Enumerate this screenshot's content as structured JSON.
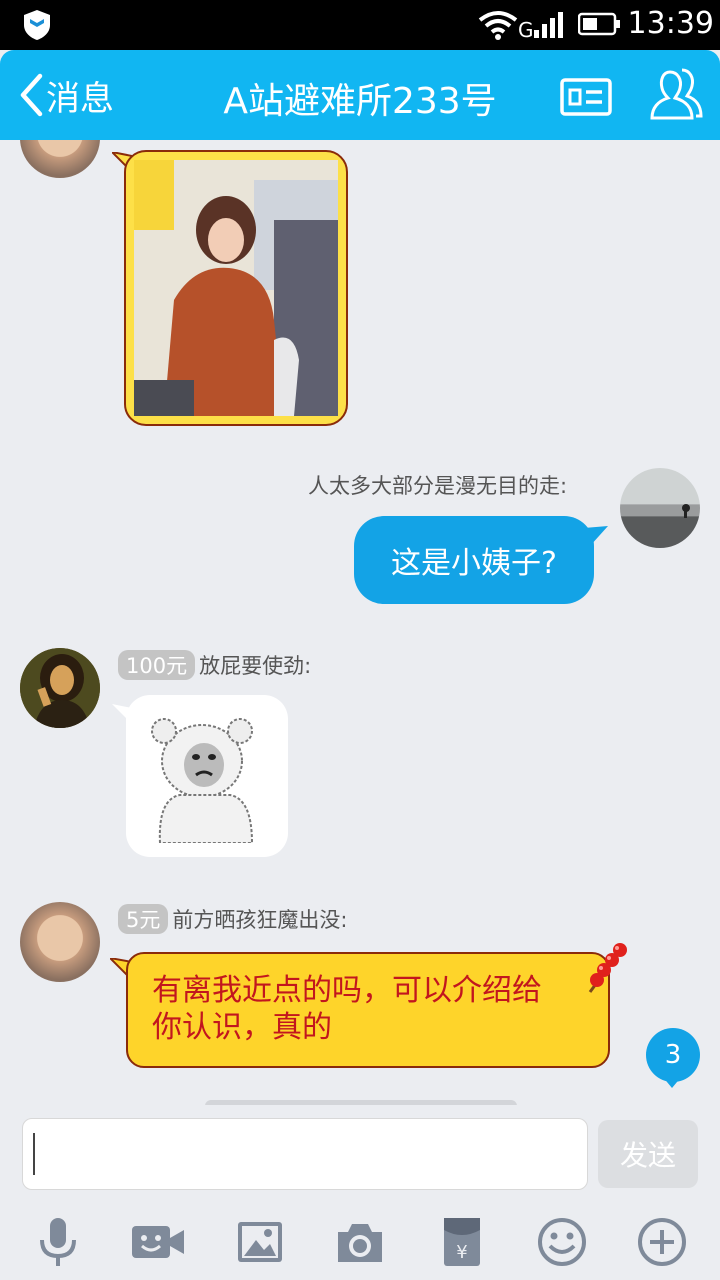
{
  "status_bar": {
    "time": "13:39"
  },
  "header": {
    "back_label": "消息",
    "title": "A站避难所233号",
    "accent_color": "#11b6f2"
  },
  "messages": [
    {
      "type": "image",
      "side": "left",
      "avatar": "baby-avatar"
    },
    {
      "type": "text",
      "side": "right",
      "sender": "人太多大部分是漫无目的走:",
      "text": "这是小姨子?",
      "avatar": "road-avatar"
    },
    {
      "type": "sticker",
      "side": "left",
      "badge": "100元",
      "sender": "放屁要使劲:",
      "avatar": "mona-lisa-avatar"
    },
    {
      "type": "text",
      "side": "left",
      "badge": "5元",
      "sender": "前方晒孩狂魔出没:",
      "text_line1": "有离我近点的吗，可以介绍给",
      "text_line2": "你认识，真的",
      "avatar": "baby-avatar"
    }
  ],
  "unread_count": "3",
  "input": {
    "value": "",
    "send_label": "发送"
  },
  "toolbar_icons": [
    "microphone-icon",
    "video-icon",
    "image-icon",
    "camera-icon",
    "red-packet-icon",
    "emoji-icon",
    "plus-icon"
  ]
}
